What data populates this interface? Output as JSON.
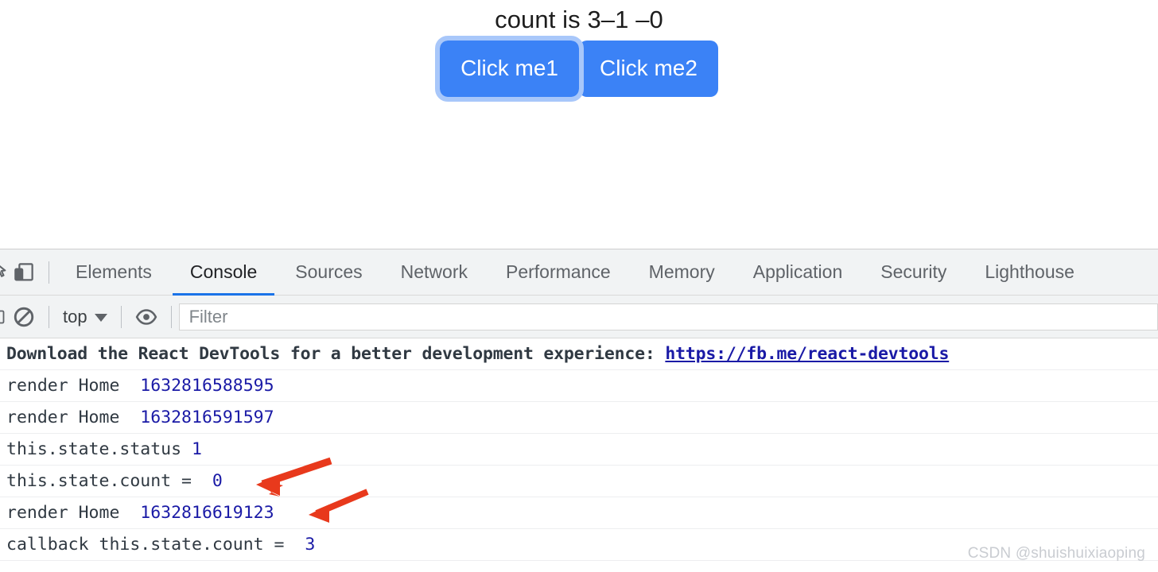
{
  "page": {
    "heading": "count is 3–1 –0",
    "buttons": [
      {
        "label": "Click me1",
        "focused": true
      },
      {
        "label": "Click me2",
        "focused": false
      }
    ]
  },
  "devtools": {
    "toolbar_icons": [
      {
        "name": "inspect-element-icon",
        "title": "Inspect"
      },
      {
        "name": "device-toolbar-icon",
        "title": "Toggle device toolbar"
      }
    ],
    "tabs": [
      {
        "label": "Elements",
        "active": false
      },
      {
        "label": "Console",
        "active": true
      },
      {
        "label": "Sources",
        "active": false
      },
      {
        "label": "Network",
        "active": false
      },
      {
        "label": "Performance",
        "active": false
      },
      {
        "label": "Memory",
        "active": false
      },
      {
        "label": "Application",
        "active": false
      },
      {
        "label": "Security",
        "active": false
      },
      {
        "label": "Lighthouse",
        "active": false
      }
    ],
    "active_tab": "Console",
    "accent_color": "#1a73e8",
    "filterbar": {
      "clear_console_title": "Clear console",
      "context_value": "top",
      "eye_title": "Live expressions",
      "filter_placeholder": "Filter",
      "filter_value": ""
    },
    "console": {
      "banner": {
        "text": "Download the React DevTools for a better development experience: ",
        "link": "https://fb.me/react-devtools"
      },
      "rows": [
        {
          "label": "render Home  ",
          "value": "1632816588595"
        },
        {
          "label": "render Home  ",
          "value": "1632816591597"
        },
        {
          "label": "this.state.status ",
          "value": "1"
        },
        {
          "label": "this.state.count =  ",
          "value": "0"
        },
        {
          "label": "render Home  ",
          "value": "1632816619123"
        },
        {
          "label": "callback this.state.count =  ",
          "value": "3"
        }
      ],
      "number_color": "#1a1aa6"
    }
  },
  "annotations": {
    "arrow_color": "#e8391c",
    "arrows": [
      {
        "name": "arrow-to-count-zero"
      },
      {
        "name": "arrow-to-render-timestamp"
      }
    ]
  },
  "watermark": {
    "text": "CSDN @shuishuixiaoping"
  }
}
